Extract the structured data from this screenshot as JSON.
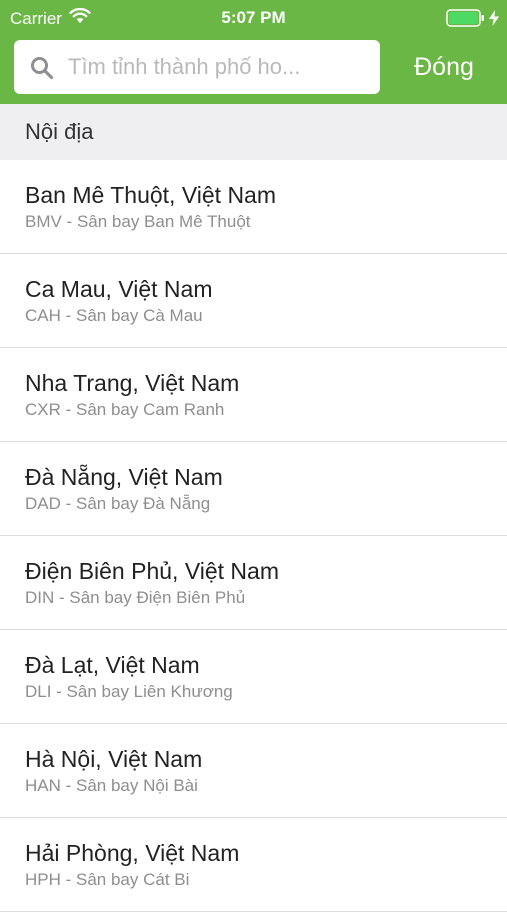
{
  "status_bar": {
    "carrier": "Carrier",
    "time": "5:07 PM"
  },
  "search": {
    "placeholder": "Tìm tỉnh thành phố ho...",
    "value": "",
    "close_label": "Đóng"
  },
  "section": {
    "title": "Nội địa"
  },
  "colors": {
    "header_green": "#6bb745",
    "section_bg": "#efeff2",
    "battery_fill": "#4cd964"
  },
  "airports": [
    {
      "title": "Ban Mê Thuột, Việt Nam",
      "subtitle": "BMV - Sân bay Ban Mê Thuột"
    },
    {
      "title": "Ca Mau, Việt Nam",
      "subtitle": "CAH - Sân bay Cà Mau"
    },
    {
      "title": "Nha Trang, Việt Nam",
      "subtitle": "CXR - Sân bay Cam Ranh"
    },
    {
      "title": "Đà Nẵng, Việt Nam",
      "subtitle": "DAD - Sân bay Đà Nẵng"
    },
    {
      "title": "Điện Biên Phủ, Việt Nam",
      "subtitle": "DIN - Sân bay Điện Biên Phủ"
    },
    {
      "title": "Đà Lạt, Việt Nam",
      "subtitle": "DLI - Sân bay Liên Khương"
    },
    {
      "title": "Hà Nội, Việt Nam",
      "subtitle": "HAN - Sân bay Nội Bài"
    },
    {
      "title": "Hải Phòng, Việt Nam",
      "subtitle": "HPH - Sân bay Cát Bi"
    }
  ]
}
